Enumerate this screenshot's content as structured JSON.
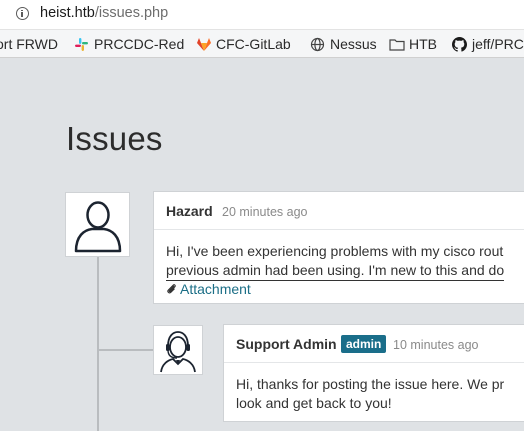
{
  "browser": {
    "url_host": "heist.htb",
    "url_path": "/issues.php"
  },
  "bookmarks": [
    {
      "label": "ort FRWD",
      "icon": "none"
    },
    {
      "label": "PRCCDC-Red",
      "icon": "slack-icon"
    },
    {
      "label": "CFC-GitLab",
      "icon": "gitlab-icon"
    },
    {
      "label": "Nessus",
      "icon": "globe-icon"
    },
    {
      "label": "HTB",
      "icon": "folder-icon"
    },
    {
      "label": "jeff/PRC",
      "icon": "github-icon"
    }
  ],
  "page": {
    "title": "Issues"
  },
  "issue": {
    "author": "Hazard",
    "time": "20 minutes ago",
    "body_line1": "Hi, I've been experiencing problems with my cisco rout",
    "body_line2": "previous admin had been using. I'm new to this and do",
    "attachment_label": "Attachment"
  },
  "reply": {
    "author": "Support Admin",
    "badge": "admin",
    "time": "10 minutes ago",
    "body_line1": "Hi, thanks for posting the issue here. We pr",
    "body_line2": "look and get back to you!"
  },
  "colors": {
    "page_bg": "#dfe2e5",
    "link": "#1b6e86",
    "badge_bg": "#1a6e8a"
  }
}
